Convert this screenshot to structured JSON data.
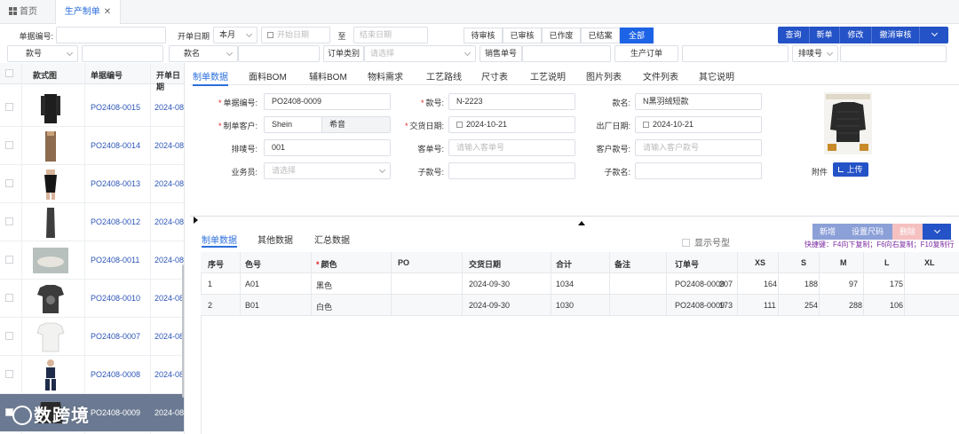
{
  "tabs": {
    "home": "首页",
    "active": "生产制单",
    "close": "✕"
  },
  "filters": {
    "doc_no_label": "单据编号:",
    "start_date_label": "开单日期",
    "period": "本月",
    "date_start_ph": "开始日期",
    "date_to": "至",
    "date_end_ph": "结束日期",
    "style_no_label": "款号",
    "style_name_label": "款名",
    "order_type_label": "订单类别",
    "order_type_ph": "请选择",
    "sales_no_label": "销售单号",
    "prod_order_label": "生产订单",
    "marker_no_label": "排唛号"
  },
  "status_segments": [
    "待审核",
    "已审核",
    "已作废",
    "已结案",
    "全部"
  ],
  "actions": [
    "查询",
    "新单",
    "修改",
    "撤消审核"
  ],
  "left_grid": {
    "headers": [
      "款式图",
      "单据编号",
      "开单日期"
    ],
    "rows": [
      {
        "no": "PO2408-0015",
        "date": "2024-08"
      },
      {
        "no": "PO2408-0014",
        "date": "2024-08"
      },
      {
        "no": "PO2408-0013",
        "date": "2024-08"
      },
      {
        "no": "PO2408-0012",
        "date": "2024-08"
      },
      {
        "no": "PO2408-0011",
        "date": "2024-08"
      },
      {
        "no": "PO2408-0010",
        "date": "2024-08"
      },
      {
        "no": "PO2408-0007",
        "date": "2024-08"
      },
      {
        "no": "PO2408-0008",
        "date": "2024-08"
      },
      {
        "no": "PO2408-0009",
        "date": "2024-08"
      }
    ]
  },
  "main_tabs": [
    "制单数据",
    "面料BOM",
    "辅料BOM",
    "物料需求",
    "工艺路线",
    "尺寸表",
    "工艺说明",
    "图片列表",
    "文件列表",
    "其它说明"
  ],
  "form": {
    "doc_no_label": "单据编号:",
    "doc_no": "PO2408-0009",
    "style_no_label": "款号:",
    "style_no": "N-2223",
    "style_name_label": "款名:",
    "style_name": "N黑羽绒短款",
    "customer_label": "制单客户:",
    "customer": "Shein",
    "customer_extra": "希音",
    "delivery_label": "交货日期:",
    "delivery": "2024-10-21",
    "ship_label": "出厂日期:",
    "ship": "2024-10-21",
    "marker_label": "排唛号:",
    "marker": "001",
    "cust_order_label": "客单号:",
    "cust_order_ph": "请输入客单号",
    "cust_style_label": "客户款号:",
    "cust_style_ph": "请输入客户款号",
    "sales_label": "业务员:",
    "sales_ph": "请选择",
    "sub_style_label": "子款号:",
    "sub_name_label": "子款名:",
    "attach_label": "附件",
    "upload": "上传"
  },
  "sub_tabs": [
    "制单数据",
    "其他数据",
    "汇总数据"
  ],
  "show_size_group": "显示号型",
  "sub_actions": [
    "新增",
    "设置尺码",
    "删除"
  ],
  "shortcut": "快捷键：F4向下复制；F6向右复制；F10复制行",
  "detail": {
    "headers": [
      "序号",
      "色号",
      "颜色",
      "PO",
      "交货日期",
      "合计",
      "备注",
      "订单号",
      "XS",
      "S",
      "M",
      "L",
      "XL"
    ],
    "rows": [
      [
        "1",
        "A01",
        "黑色",
        "",
        "2024-09-30",
        "1034",
        "",
        "PO2408-0009",
        "207",
        "164",
        "188",
        "97",
        "175"
      ],
      [
        "2",
        "B01",
        "白色",
        "",
        "2024-09-30",
        "1030",
        "",
        "PO2408-0009",
        "173",
        "111",
        "254",
        "288",
        "106"
      ]
    ]
  },
  "brand_logo": "数跨境"
}
